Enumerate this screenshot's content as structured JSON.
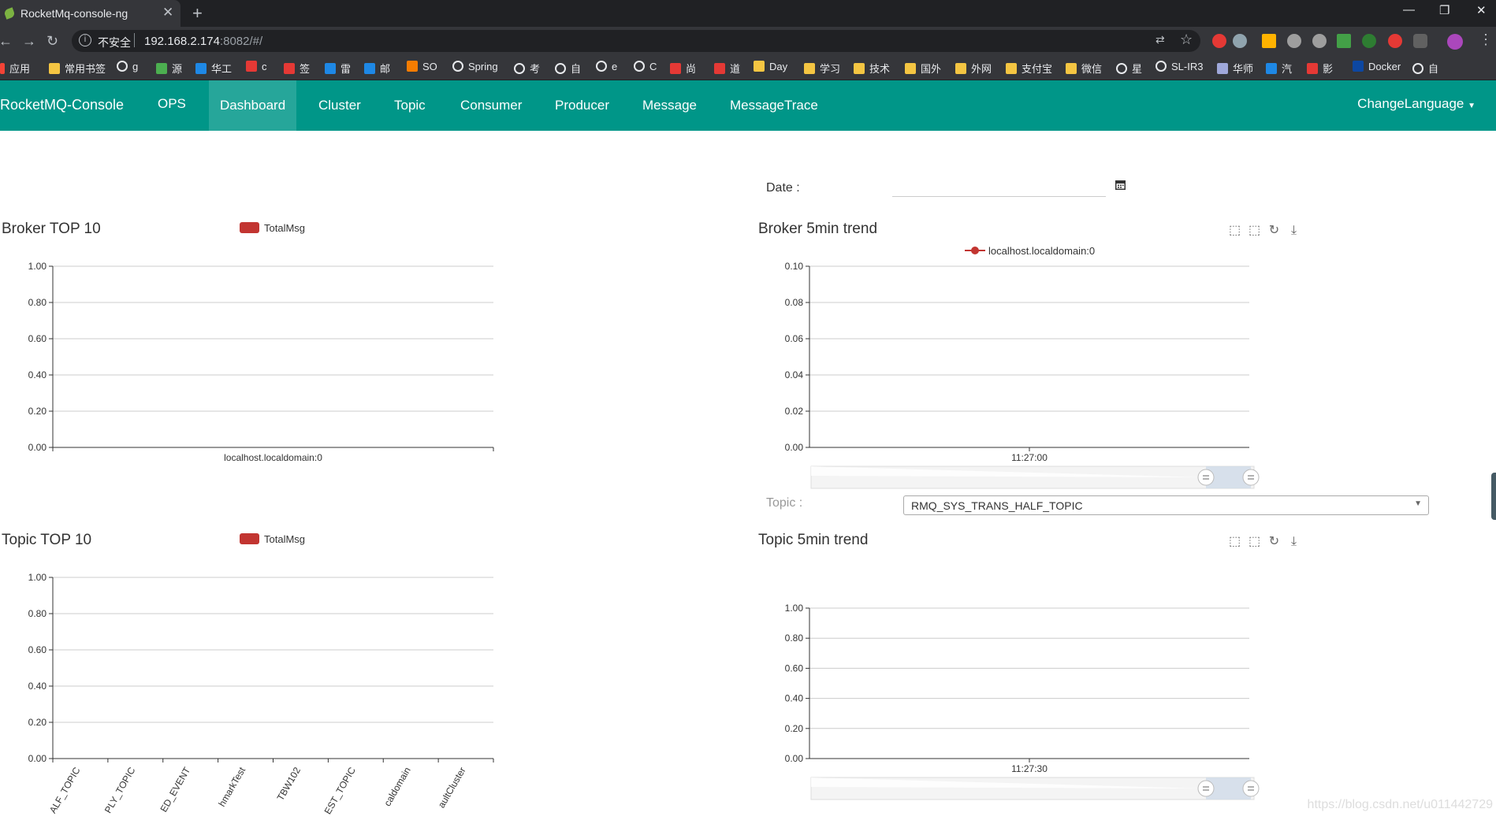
{
  "browser": {
    "tab_title": "RocketMq-console-ng",
    "security_label": "不安全",
    "url_host": "192.168.2.174",
    "url_rest": ":8082/#/",
    "bookmarks": [
      "应用",
      "常用书签",
      "g",
      "源",
      "华工",
      "c",
      "签",
      "雷",
      "邮",
      "SO",
      "Spring",
      "考",
      "自",
      "e",
      "C",
      "尚",
      "道",
      "Day",
      "学习",
      "技术",
      "国外",
      "外网",
      "支付宝",
      "微信",
      "星",
      "SL-IR3",
      "华师",
      "汽",
      "影",
      "Docker",
      "自"
    ]
  },
  "app": {
    "brand": "RocketMQ-Console",
    "nav": [
      "OPS",
      "Dashboard",
      "Cluster",
      "Topic",
      "Consumer",
      "Producer",
      "Message",
      "MessageTrace"
    ],
    "active_nav": "Dashboard",
    "change_language": "ChangeLanguage"
  },
  "filters": {
    "date_label": "Date :",
    "date_value": "",
    "topic_label": "Topic :",
    "topic_selected": "RMQ_SYS_TRANS_HALF_TOPIC"
  },
  "watermark": "https://blog.csdn.net/u011442729",
  "colors": {
    "nav_bg": "#009688",
    "nav_active": "#26a69a",
    "series": "#c23531"
  },
  "chart_data": [
    {
      "id": "broker_top10",
      "type": "bar",
      "title": "Broker TOP 10",
      "legend": [
        "TotalMsg"
      ],
      "categories": [
        "localhost.localdomain:0"
      ],
      "values": [
        0
      ],
      "ylim": [
        0,
        1
      ],
      "yticks": [
        "0.00",
        "0.20",
        "0.40",
        "0.60",
        "0.80",
        "1.00"
      ]
    },
    {
      "id": "broker_trend",
      "type": "line",
      "title": "Broker 5min trend",
      "legend": [
        "localhost.localdomain:0"
      ],
      "x": [
        "11:27:00"
      ],
      "ylim": [
        0,
        0.1
      ],
      "yticks": [
        "0.00",
        "0.02",
        "0.04",
        "0.06",
        "0.08",
        "0.10"
      ]
    },
    {
      "id": "topic_top10",
      "type": "bar",
      "title": "Topic TOP 10",
      "legend": [
        "TotalMsg"
      ],
      "categories": [
        "ALF_TOPIC",
        "PLY_TOPIC",
        "ED_EVENT",
        "hmarkTest",
        "TBW102",
        "EST_TOPIC",
        "caldomain",
        "aultCluster"
      ],
      "values": [
        0,
        0,
        0,
        0,
        0,
        0,
        0,
        0
      ],
      "ylim": [
        0,
        1
      ],
      "yticks": [
        "0.00",
        "0.20",
        "0.40",
        "0.60",
        "0.80",
        "1.00"
      ]
    },
    {
      "id": "topic_trend",
      "type": "line",
      "title": "Topic 5min trend",
      "legend": [],
      "x": [
        "11:27:30"
      ],
      "ylim": [
        0,
        1
      ],
      "yticks": [
        "0.00",
        "0.20",
        "0.40",
        "0.60",
        "0.80",
        "1.00"
      ]
    }
  ]
}
